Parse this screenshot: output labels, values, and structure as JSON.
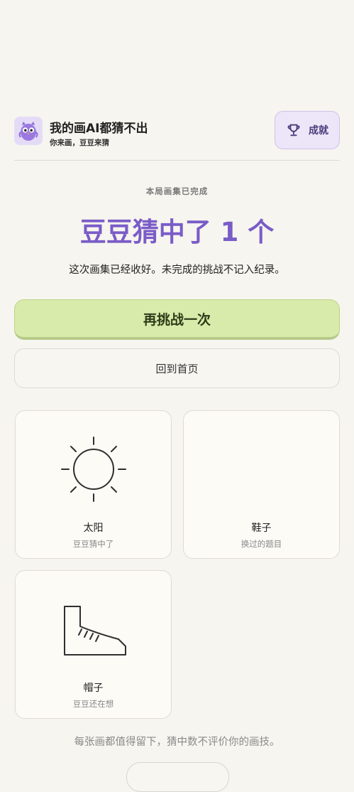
{
  "header": {
    "app_title": "我的画AI都猜不出",
    "app_subtitle": "你来画，豆豆来猜",
    "achievements_label": "成就"
  },
  "result": {
    "kicker": "本局画集已完成",
    "headline": "豆豆猜中了 1 个",
    "message": "这次画集已经收好。未完成的挑战不记入纪录。"
  },
  "actions": {
    "retry_label": "再挑战一次",
    "home_label": "回到首页"
  },
  "drawings": [
    {
      "label": "太阳",
      "status": "豆豆猜中了",
      "icon": "sun-drawing"
    },
    {
      "label": "鞋子",
      "status": "换过的题目",
      "icon": ""
    },
    {
      "label": "帽子",
      "status": "豆豆还在想",
      "icon": "shoe-drawing"
    }
  ],
  "footer": {
    "note": "每张画都值得留下，猜中数不评价你的画技。"
  },
  "colors": {
    "accent_purple": "#7a5cc8",
    "primary_green": "#d9ebaa",
    "background": "#f6f5ef"
  }
}
